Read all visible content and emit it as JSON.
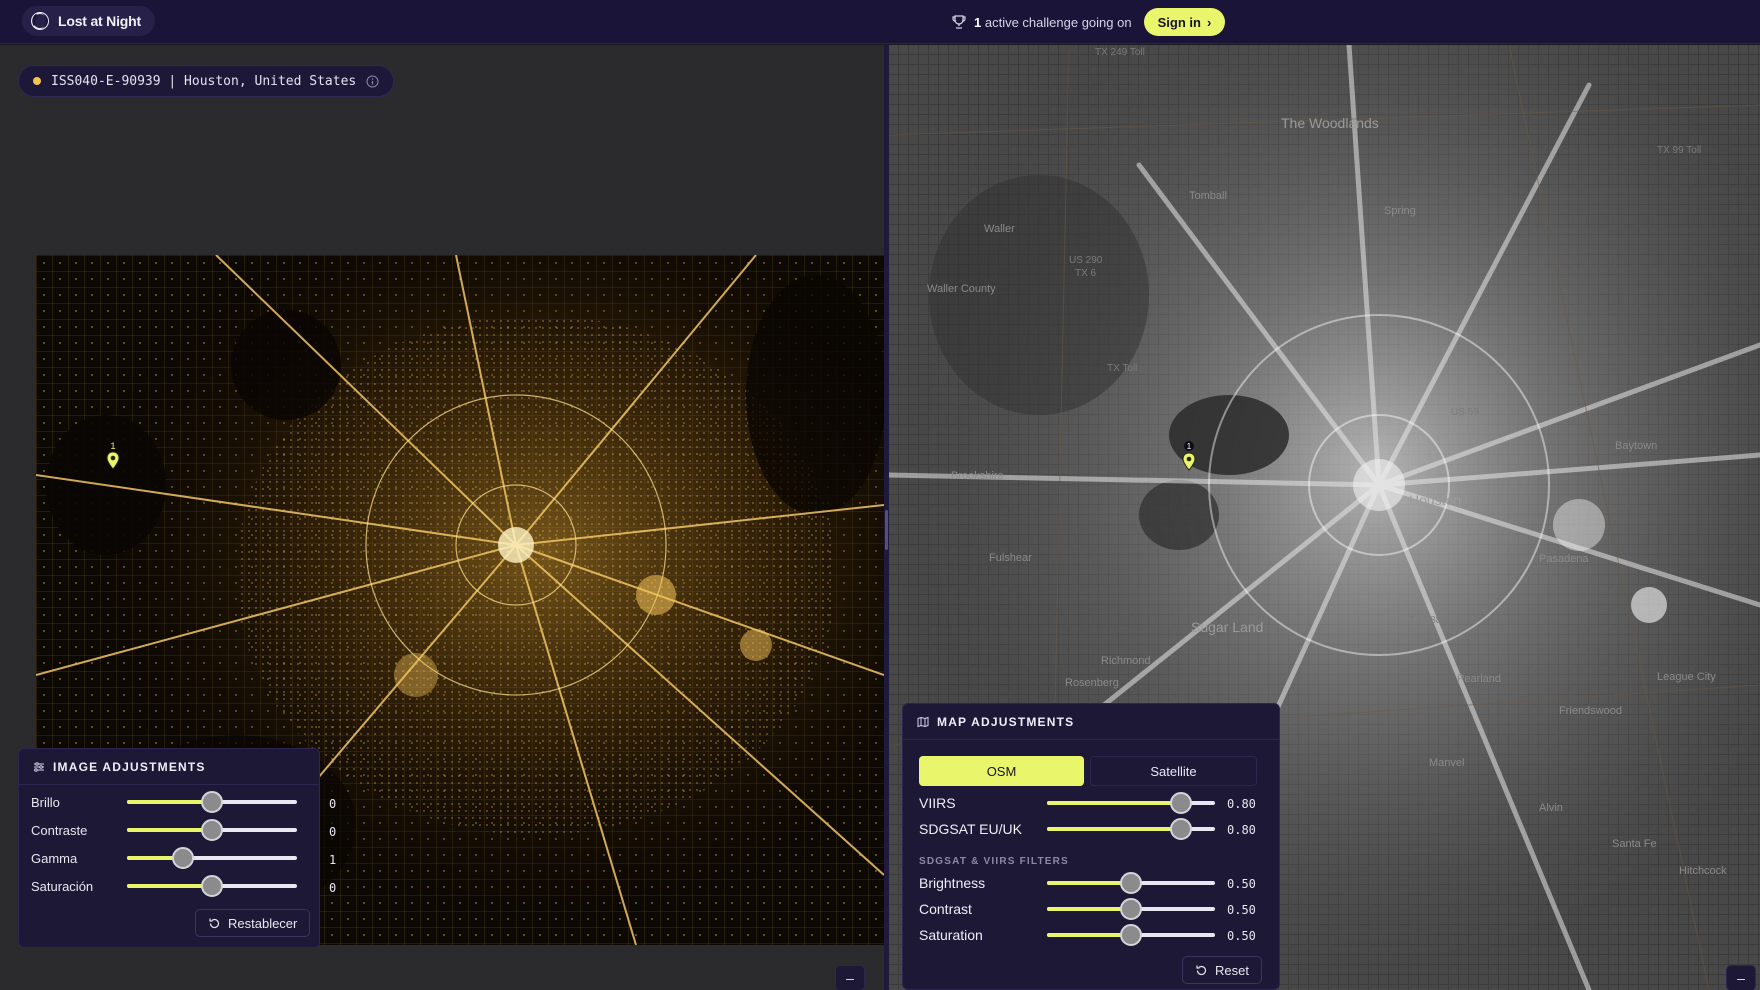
{
  "header": {
    "brand": "Lost at Night",
    "challenge_count": "1",
    "challenge_text": "active challenge going on",
    "signin_label": "Sign in",
    "signin_arrow": "›"
  },
  "image_info": {
    "id_location": "ISS040-E-90939 | Houston, United States"
  },
  "pins": {
    "left_label": "1",
    "right_label": "1"
  },
  "image_adjustments": {
    "title": "IMAGE ADJUSTMENTS",
    "sliders": [
      {
        "label": "Brillo",
        "value": "0",
        "fraction": 0.5
      },
      {
        "label": "Contraste",
        "value": "0",
        "fraction": 0.5
      },
      {
        "label": "Gamma",
        "value": "1",
        "fraction": 0.33
      },
      {
        "label": "Saturación",
        "value": "0",
        "fraction": 0.5
      }
    ],
    "reset_label": "Restablecer"
  },
  "map_adjustments": {
    "title": "MAP ADJUSTMENTS",
    "layers": [
      {
        "label": "OSM",
        "active": true
      },
      {
        "label": "Satellite",
        "active": false
      }
    ],
    "layer_sliders": [
      {
        "label": "VIIRS",
        "value": "0.80",
        "fraction": 0.8
      },
      {
        "label": "SDGSAT EU/UK",
        "value": "0.80",
        "fraction": 0.8
      }
    ],
    "filters_caption": "SDGSAT & VIIRS FILTERS",
    "filter_sliders": [
      {
        "label": "Brightness",
        "value": "0.50",
        "fraction": 0.5
      },
      {
        "label": "Contrast",
        "value": "0.50",
        "fraction": 0.5
      },
      {
        "label": "Saturation",
        "value": "0.50",
        "fraction": 0.5
      }
    ],
    "reset_label": "Reset"
  },
  "collapse_glyph": "–",
  "map_labels": {
    "the_woodlands": "The Woodlands",
    "houston": "Houston",
    "sugar_land": "Sugar Land",
    "brookshire": "Brookshire",
    "fulshear": "Fulshear",
    "richmond": "Richmond",
    "rosenberg": "Rosenberg",
    "pearland": "Pearland",
    "friendswood": "Friendswood",
    "manvel": "Manvel",
    "alvin": "Alvin",
    "waller": "Waller",
    "waller_county": "Waller County",
    "tomball": "Tomball",
    "spring": "Spring",
    "baytown": "Baytown",
    "pasadena": "Pasadena",
    "tx249": "TX 249 Toll",
    "tx99": "TX 99 Toll",
    "us290": "US 290",
    "tx6": "TX 6",
    "tx_toll": "TX Toll",
    "us59": "US 59",
    "tx288": "TX 288",
    "santa_fe": "Santa Fe",
    "hitchcock": "Hitchcock",
    "league_city": "League City"
  },
  "colors": {
    "accent": "#e9f56a",
    "header_bg": "#1a1438",
    "panel_bg": "#1d1836",
    "city_light": "#f3c54e"
  }
}
